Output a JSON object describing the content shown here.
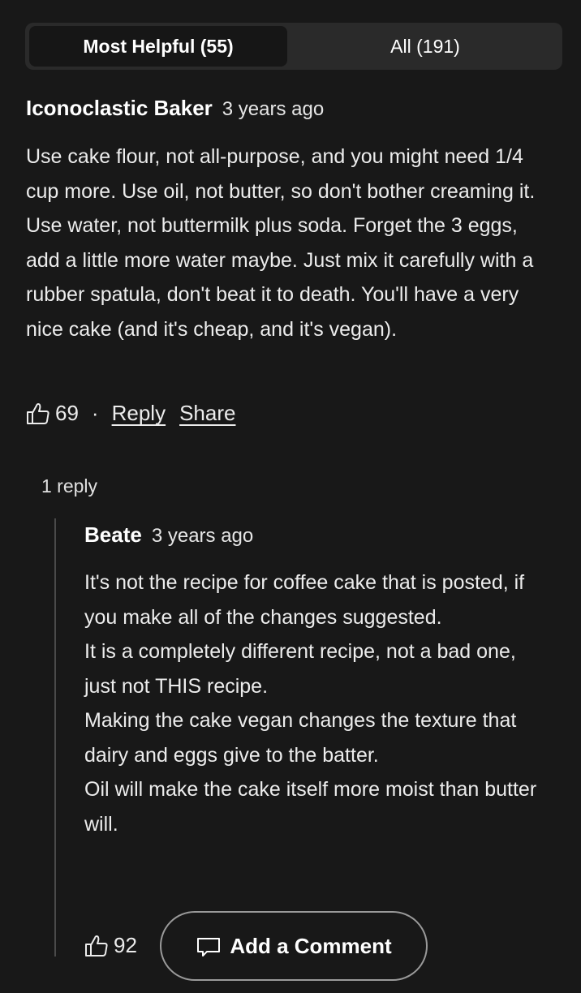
{
  "tabs": {
    "most_helpful": "Most Helpful (55)",
    "all": "All (191)"
  },
  "comment": {
    "author": "Iconoclastic Baker",
    "time": "3 years ago",
    "text": "Use cake flour, not all-purpose, and you might need 1/4 cup more. Use oil, not butter, so don't bother creaming it. Use water, not buttermilk plus soda. Forget the 3 eggs, add a little more water maybe. Just mix it carefully with a rubber spatula, don't beat it to death. You'll have a very nice cake (and it's cheap, and it's vegan).",
    "likes": "69",
    "separator": "·",
    "reply_label": "Reply",
    "share_label": "Share",
    "reply_count": "1 reply"
  },
  "reply": {
    "author": "Beate",
    "time": "3 years ago",
    "text": "It's not the recipe for coffee cake that is posted, if you make all of the changes suggested.\nIt is a completely different recipe, not a bad one, just not THIS recipe.\nMaking the cake vegan changes the texture that dairy and eggs give to the batter.\nOil will make the cake itself more moist than butter will.",
    "likes": "92"
  },
  "add_comment": {
    "label": "Add a Comment"
  },
  "icons": {
    "like": "thumbs-up-icon",
    "comment": "comment-bubble-icon"
  },
  "colors": {
    "background": "#181818",
    "tab_bar": "#2a2a2a",
    "text": "#ececec"
  }
}
